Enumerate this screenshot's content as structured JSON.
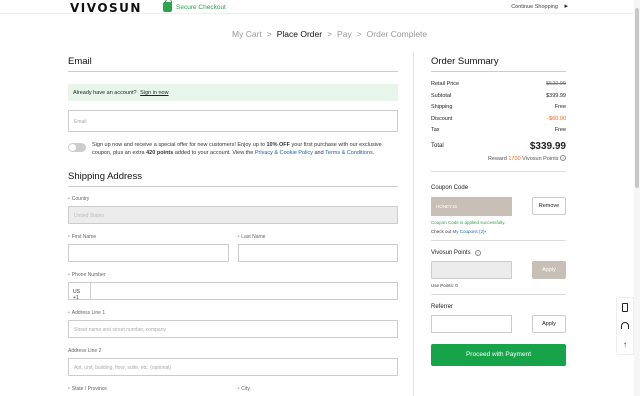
{
  "header": {
    "logo": "VIVOSUN",
    "secure_checkout": "Secure Checkout",
    "continue_shopping": "Continue Shopping"
  },
  "steps": [
    "My Cart",
    "Place Order",
    "Pay",
    "Order Complete"
  ],
  "active_step": "Place Order",
  "email": {
    "title": "Email",
    "account_prompt": "Already have an account?",
    "sign_in": "Sign in now",
    "placeholder": "Email",
    "optin_text_1": "Sign up now and receive a special offer for new customers! Enjoy up to ",
    "optin_bold_1": "10% OFF",
    "optin_text_2": " your first purchase with our exclusive coupon, plus an extra ",
    "optin_bold_2": "420 points",
    "optin_text_3": " added to your account. View the ",
    "privacy_link": "Privacy & Cookie Policy",
    "and": " and ",
    "terms_link": "Terms & Conditions",
    "period": "."
  },
  "shipping": {
    "title": "Shipping Address",
    "country_label": "Country",
    "country_value": "United States",
    "first_name_label": "First Name",
    "last_name_label": "Last Name",
    "phone_label": "Phone Number",
    "phone_code": "US +1",
    "address1_label": "Address Line 1",
    "address1_placeholder": "Street name and street number, company",
    "address2_label": "Address Line 2",
    "address2_placeholder": "Apt, unit, building, floor, suite, etc. (optional)",
    "state_label": "State / Province",
    "city_label": "City"
  },
  "summary": {
    "title": "Order Summary",
    "rows": [
      {
        "label": "Retail Price",
        "value": "$529.99"
      },
      {
        "label": "Subtotal",
        "value": "$399.99"
      },
      {
        "label": "Shipping",
        "value": "Free"
      },
      {
        "label": "Discount",
        "value": "-$60.00"
      },
      {
        "label": "Tax",
        "value": "Free"
      }
    ],
    "total_label": "Total",
    "total_value": "$339.99",
    "reward_prefix": "Reward ",
    "reward_points": "1700",
    "reward_suffix": " Vivosun Points"
  },
  "coupon": {
    "title": "Coupon Code",
    "value": "HONEY15",
    "remove": "Remove",
    "success": "Coupon Code is applied successfully.",
    "check_prefix": "Check out ",
    "my_coupons": "My Coupons (2)"
  },
  "points": {
    "title": "Vivosun Points",
    "apply": "Apply",
    "use_points": "Use Points: 0"
  },
  "referrer": {
    "title": "Referrer",
    "apply": "Apply"
  },
  "proceed": "Proceed with Payment",
  "colors": {
    "accent_green": "#16a34a",
    "discount_orange": "#e8661f",
    "link_blue": "#1a5fb4"
  }
}
